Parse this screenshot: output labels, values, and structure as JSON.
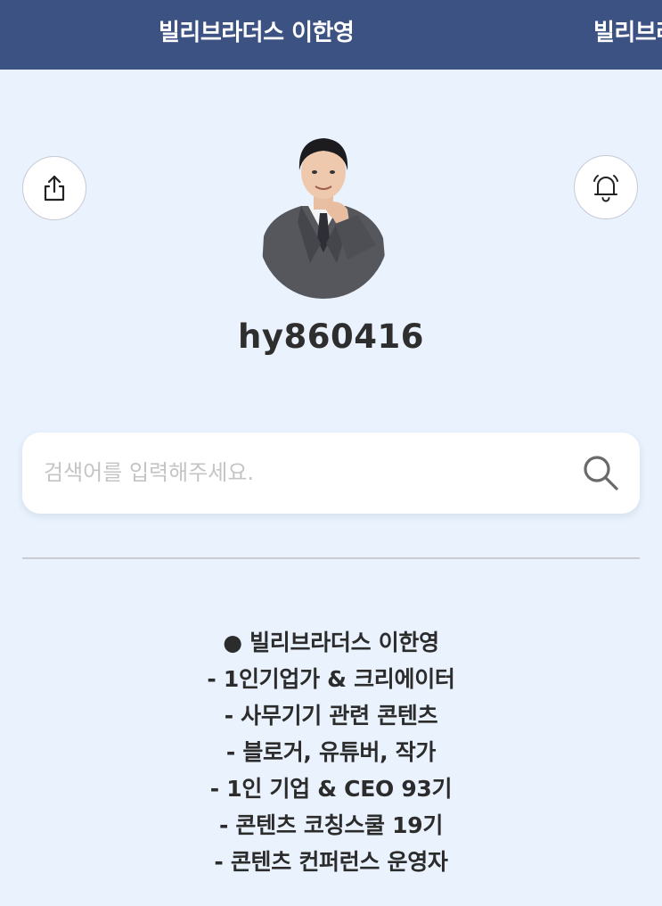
{
  "header": {
    "title": "빌리브라더스 이한영",
    "next_title": "빌리브라"
  },
  "profile": {
    "username": "hy860416"
  },
  "search": {
    "placeholder": "검색어를 입력해주세요."
  },
  "bio": {
    "lines": [
      "● 빌리브라더스 이한영",
      "- 1인기업가 & 크리에이터",
      "- 사무기기 관련 콘텐츠",
      "- 블로거, 유튜버, 작가",
      "- 1인 기업 & CEO 93기",
      "- 콘텐츠 코칭스쿨 19기",
      "- 콘텐츠 컨퍼런스 운영자"
    ]
  },
  "icons": {
    "share": "share-icon",
    "bell": "bell-icon",
    "search": "search-icon"
  },
  "colors": {
    "header_bg": "#3c5283",
    "page_bg": "#e9f2fd",
    "text": "#2c2c2c",
    "placeholder": "#c4c4c4"
  }
}
